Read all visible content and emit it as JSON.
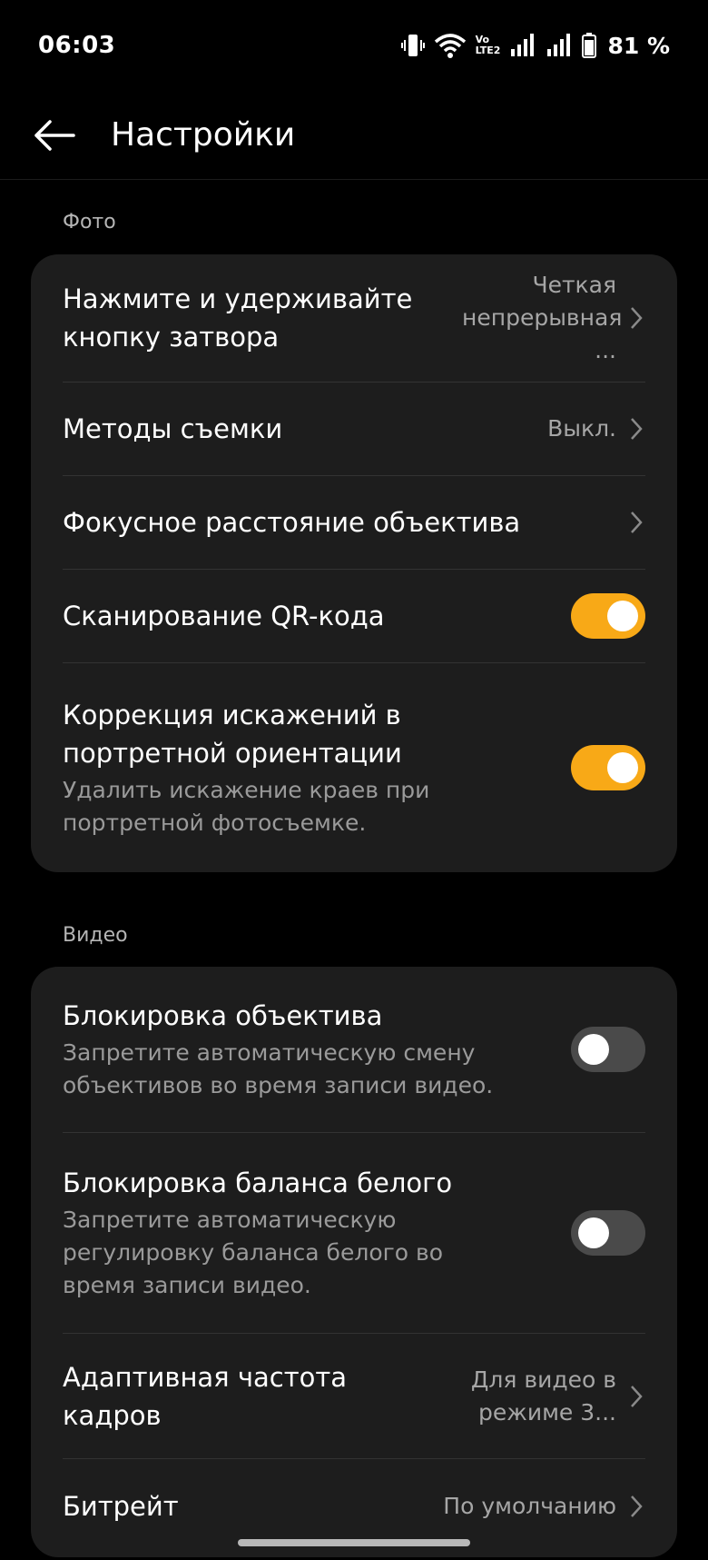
{
  "status_bar": {
    "time": "06:03",
    "volte_top": "Vo",
    "volte_bottom": "LTE2",
    "battery": "81 %"
  },
  "header": {
    "back_icon": "arrow-left-icon",
    "title": "Настройки"
  },
  "sections": {
    "photo": {
      "label": "Фото",
      "rows": {
        "shutter_hold": {
          "title": "Нажмите и удерживайте кнопку затвора",
          "value": "Четкая непрерывная ..."
        },
        "shooting_methods": {
          "title": "Методы съемки",
          "value": "Выкл."
        },
        "focal_length": {
          "title": "Фокусное расстояние объектива"
        },
        "qr_scan": {
          "title": "Сканирование QR-кода",
          "enabled": true
        },
        "distortion": {
          "title": "Коррекция искажений в портретной ориентации",
          "subtitle": "Удалить искажение краев при портретной фотосъемке.",
          "enabled": true
        }
      }
    },
    "video": {
      "label": "Видео",
      "rows": {
        "lens_lock": {
          "title": "Блокировка объектива",
          "subtitle": "Запретите автоматическую смену объективов во время записи видео.",
          "enabled": false
        },
        "wb_lock": {
          "title": "Блокировка баланса белого",
          "subtitle": "Запретите автоматическую регулировку баланса белого во время записи видео.",
          "enabled": false
        },
        "adaptive_fps": {
          "title": "Адаптивная частота кадров",
          "value": "Для видео в режиме 3..."
        },
        "bitrate": {
          "title": "Битрейт",
          "value": "По умолчанию"
        }
      }
    }
  },
  "colors": {
    "accent": "#f8a917",
    "card": "#1d1d1d",
    "background": "#000000"
  }
}
